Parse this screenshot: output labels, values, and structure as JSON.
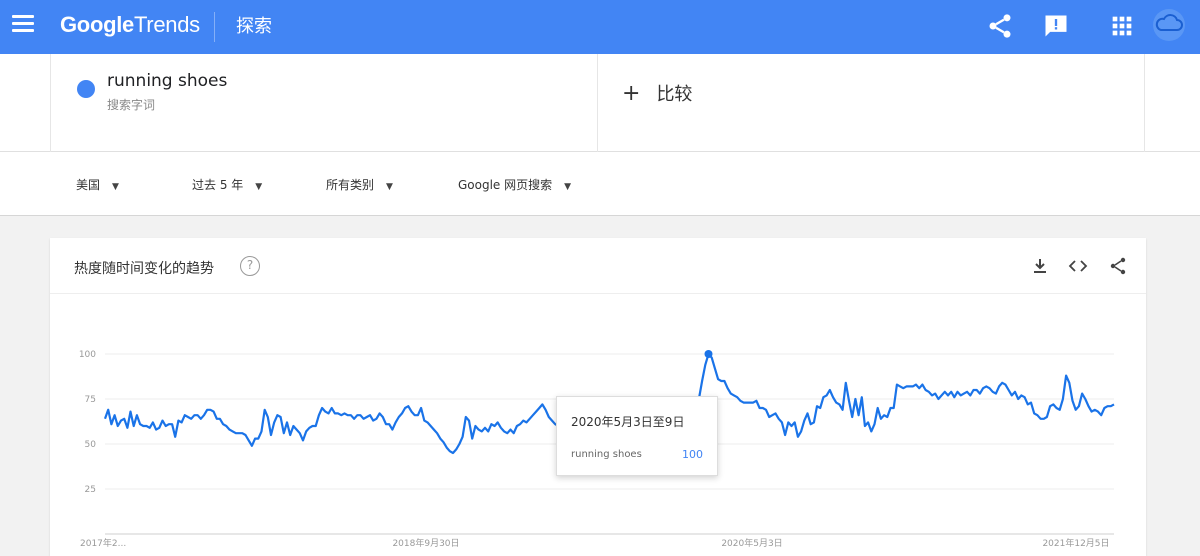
{
  "app": {
    "logo_google": "Google",
    "logo_trends": "Trends",
    "section": "探索"
  },
  "icons": {
    "menu": "menu-icon",
    "share": "share-icon",
    "feedback": "feedback-icon",
    "apps": "apps-grid-icon",
    "account": "cloud-avatar-icon"
  },
  "term": {
    "name": "running shoes",
    "type": "搜索字词",
    "color": "#4285f4"
  },
  "compare": {
    "plus": "+",
    "label": "比较"
  },
  "filters": [
    {
      "label": "美国"
    },
    {
      "label": "过去 5 年"
    },
    {
      "label": "所有类别"
    },
    {
      "label": "Google 网页搜索"
    }
  ],
  "card": {
    "title": "热度随时间变化的趋势",
    "help": "?"
  },
  "tooltip": {
    "date": "2020年5月3日至9日",
    "term": "running shoes",
    "value": "100"
  },
  "colors": {
    "brand": "#4285f4",
    "line": "#1a73e8"
  },
  "chart_data": {
    "type": "line",
    "y_ticks": [
      "100",
      "75",
      "50",
      "25"
    ],
    "x_labels": [
      "2017年2...",
      "2018年9月30日",
      "2020年5月3日",
      "2021年12月5日"
    ],
    "ylim": [
      0,
      100
    ],
    "grid": true,
    "series": [
      {
        "name": "running shoes",
        "values": [
          64,
          69,
          61,
          66,
          60,
          63,
          64,
          59,
          68,
          60,
          66,
          61,
          60,
          60,
          59,
          62,
          58,
          59,
          63,
          60,
          61,
          61,
          54,
          63,
          62,
          66,
          65,
          64,
          66,
          66,
          64,
          66,
          69,
          69,
          68,
          64,
          64,
          61,
          60,
          58,
          57,
          56,
          56,
          56,
          55,
          52,
          49,
          53,
          53,
          57,
          69,
          65,
          55,
          62,
          66,
          65,
          56,
          62,
          55,
          60,
          58,
          56,
          52,
          57,
          59,
          60,
          60,
          66,
          70,
          68,
          67,
          70,
          67,
          67,
          66,
          67,
          66,
          66,
          64,
          66,
          66,
          64,
          65,
          66,
          63,
          64,
          67,
          65,
          61,
          61,
          58,
          62,
          65,
          67,
          70,
          71,
          68,
          66,
          66,
          70,
          63,
          62,
          60,
          58,
          56,
          53,
          51,
          48,
          46,
          45,
          47,
          50,
          54,
          65,
          63,
          53,
          60,
          58,
          57,
          59,
          57,
          61,
          60,
          62,
          59,
          57,
          56,
          58,
          56,
          60,
          61,
          63,
          62,
          64,
          66,
          68,
          70,
          72,
          69,
          65,
          63,
          61,
          60,
          59,
          58,
          60,
          56,
          60,
          61,
          60,
          65,
          63,
          60,
          58,
          59,
          62,
          65,
          61,
          62,
          60,
          59,
          64,
          55,
          62,
          52,
          56,
          52,
          55,
          57,
          60,
          61,
          62,
          58,
          52,
          60,
          64,
          61,
          62,
          63,
          70,
          68,
          66,
          56,
          49,
          58,
          67,
          75,
          85,
          94,
          100,
          98,
          92,
          86,
          85,
          85,
          81,
          78,
          77,
          76,
          74,
          73,
          73,
          73,
          73,
          74,
          70,
          70,
          69,
          65,
          66,
          67,
          64,
          62,
          55,
          62,
          60,
          62,
          54,
          57,
          63,
          67,
          61,
          62,
          71,
          70,
          76,
          77,
          80,
          76,
          73,
          72,
          69,
          84,
          74,
          65,
          75,
          66,
          76,
          60,
          62,
          57,
          61,
          70,
          64,
          66,
          65,
          70,
          70,
          83,
          82,
          81,
          82,
          82,
          82,
          83,
          81,
          83,
          80,
          79,
          77,
          78,
          75,
          77,
          79,
          77,
          79,
          76,
          79,
          77,
          78,
          79,
          77,
          80,
          80,
          78,
          81,
          82,
          81,
          79,
          78,
          82,
          84,
          83,
          80,
          77,
          79,
          75,
          77,
          76,
          72,
          73,
          67,
          66,
          64,
          64,
          65,
          71,
          72,
          70,
          69,
          75,
          88,
          84,
          74,
          69,
          71,
          78,
          75,
          71,
          68,
          69,
          68,
          66,
          70,
          71,
          71,
          72
        ]
      }
    ],
    "highlight": {
      "label": "2020年5月3日",
      "value": 100
    }
  }
}
